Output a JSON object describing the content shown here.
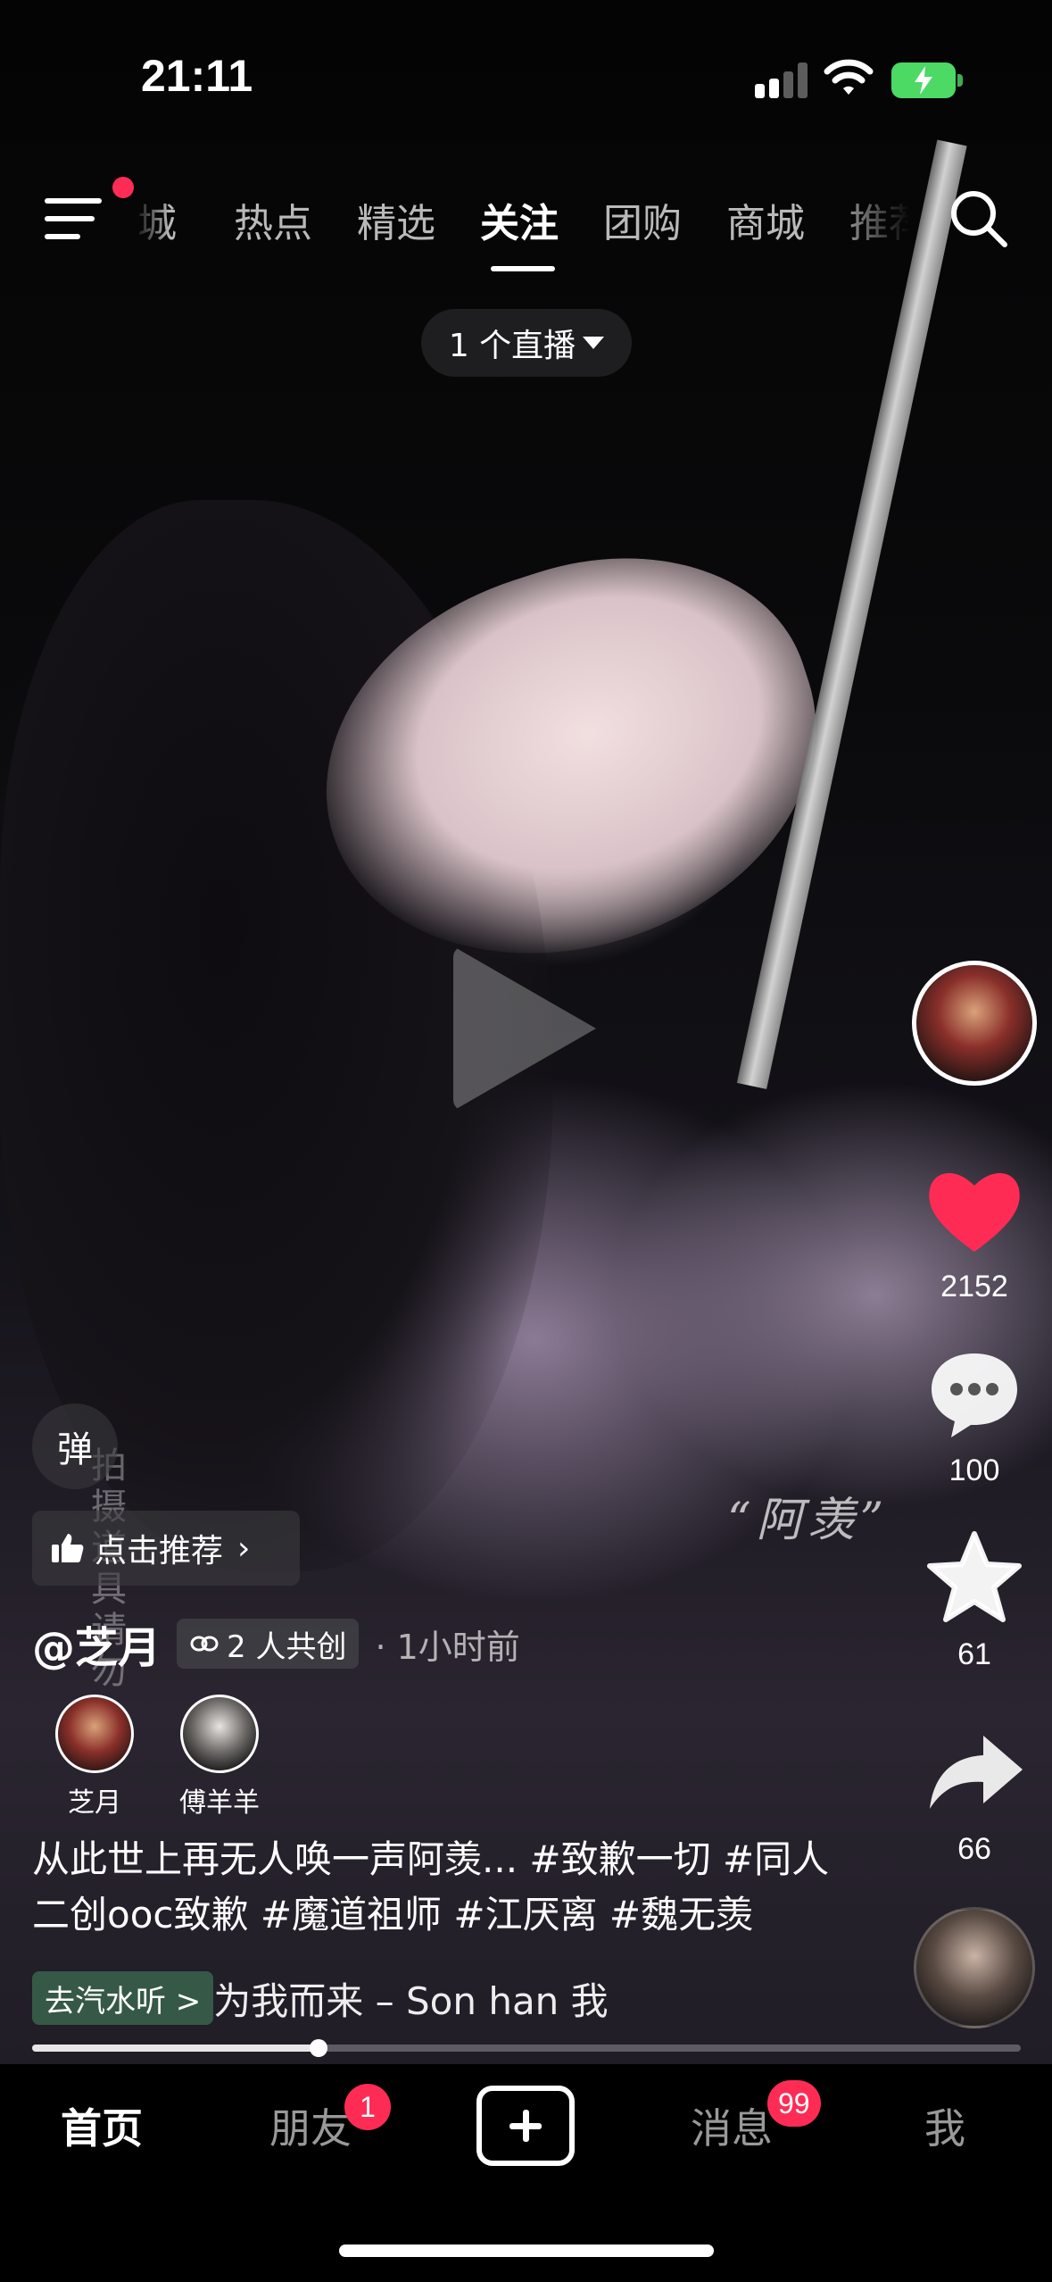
{
  "status": {
    "time": "21:11"
  },
  "topnav": {
    "tabs": [
      {
        "label": "同城",
        "active": false
      },
      {
        "label": "热点",
        "active": false
      },
      {
        "label": "精选",
        "active": false
      },
      {
        "label": "关注",
        "active": true
      },
      {
        "label": "团购",
        "active": false
      },
      {
        "label": "商城",
        "active": false
      },
      {
        "label": "推荐",
        "active": false
      }
    ],
    "live_pill": "1 个直播"
  },
  "video": {
    "watermark": "“阿羡”",
    "vertical_text": "拍摄道具请勿"
  },
  "actions": {
    "likes": "2152",
    "comments": "100",
    "favorites": "61",
    "shares": "66",
    "like_color": "#fe2c55"
  },
  "info": {
    "danmu": "弹",
    "recommend": "点击推荐",
    "author": "@芝月",
    "cocreate": "2 人共创",
    "time_ago": "· 1小时前",
    "creators": [
      {
        "name": "芝月"
      },
      {
        "name": "傅羊羊"
      }
    ],
    "caption": "从此世上再无人唤一声阿羡... #致歉一切 #同人二创ooc致歉 #魔道祖师 #江厌离 #魏无羡",
    "music_tag": "去汽水听 >",
    "music_text": "为我而来 – Son han    我",
    "progress": 0.29
  },
  "tabbar": {
    "home": "首页",
    "friends": "朋友",
    "friends_badge": "1",
    "messages": "消息",
    "messages_badge": "99",
    "me": "我",
    "accent": "#fe2c55"
  }
}
